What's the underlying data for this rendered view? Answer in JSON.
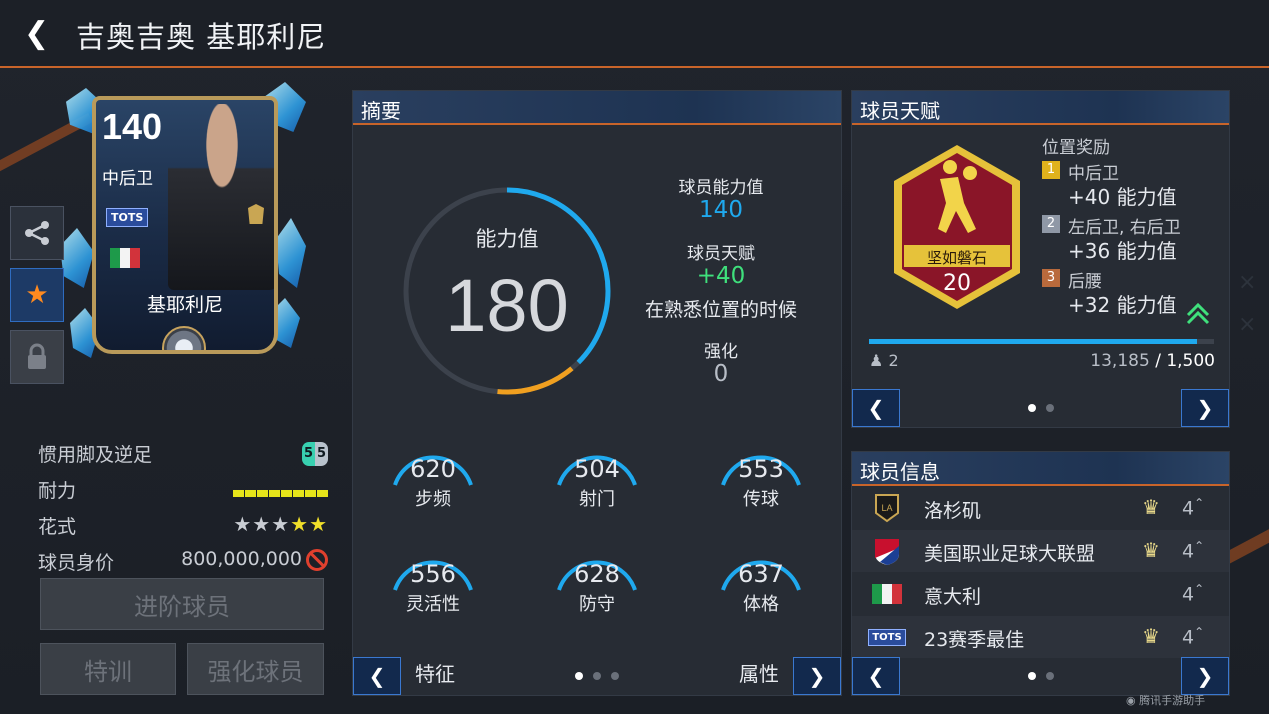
{
  "header": {
    "title": "吉奥吉奥 基耶利尼"
  },
  "card": {
    "rating": "140",
    "position": "中后卫",
    "badge": "TOTS",
    "name": "基耶利尼"
  },
  "side_buttons": [
    "share-icon",
    "star-icon",
    "lock-icon"
  ],
  "stats": {
    "foot_label": "惯用脚及逆足",
    "foot_strong": "5",
    "foot_weak": "5",
    "stamina_label": "耐力",
    "skill_label": "花式",
    "skill_stars_empty": "★★★",
    "skill_stars_full": "★★",
    "value_label": "球员身价",
    "value": "800,000,000"
  },
  "buttons": {
    "advance": "进阶球员",
    "train": "特训",
    "boost": "强化球员"
  },
  "summary": {
    "title": "摘要",
    "ring_label": "能力值",
    "ring_value": "180",
    "ability_label": "球员能力值",
    "ability_value": "140",
    "talent_label": "球员天赋",
    "talent_value": "+40",
    "talent_note": "在熟悉位置的时候",
    "enhance_label": "强化",
    "enhance_value": "0",
    "attributes": [
      {
        "value": "620",
        "label": "步频"
      },
      {
        "value": "504",
        "label": "射门"
      },
      {
        "value": "553",
        "label": "传球"
      },
      {
        "value": "556",
        "label": "灵活性"
      },
      {
        "value": "628",
        "label": "防守"
      },
      {
        "value": "637",
        "label": "体格"
      }
    ],
    "nav_left_label": "特征",
    "nav_right_label": "属性"
  },
  "talent": {
    "title": "球员天赋",
    "badge_name": "坚如磐石",
    "badge_level": "20",
    "bonus_title": "位置奖励",
    "bonuses": [
      {
        "rank": "1",
        "position": "中后卫",
        "bonus": "+40 能力值",
        "color": "#e0b21c"
      },
      {
        "rank": "2",
        "position": "左后卫, 右后卫",
        "bonus": "+36 能力值",
        "color": "#8f98a6"
      },
      {
        "rank": "3",
        "position": "后腰",
        "bonus": "+32 能力值",
        "color": "#b96a3c"
      }
    ],
    "level_count": "2",
    "xp_current": "13,185",
    "xp_total": "/ 1,500",
    "xp_progress": 0.95
  },
  "info": {
    "title": "球员信息",
    "rows": [
      {
        "icon": "lafc-logo-icon",
        "text": "洛杉矶",
        "count": "4"
      },
      {
        "icon": "mls-logo-icon",
        "text": "美国职业足球大联盟",
        "count": "4"
      },
      {
        "icon": "italy-flag-icon",
        "text": "意大利",
        "count": "4"
      },
      {
        "icon": "tots-logo-icon",
        "text": "23赛季最佳",
        "count": "4"
      }
    ]
  },
  "watermark": "腾讯手游助手",
  "colors": {
    "accent": "#c8642a",
    "ring_blue": "#1fa9ee",
    "ring_orange": "#f0a020",
    "talent_green": "#3fe07c",
    "badge_red": "#8a1528",
    "badge_gold": "#e6c23a"
  }
}
